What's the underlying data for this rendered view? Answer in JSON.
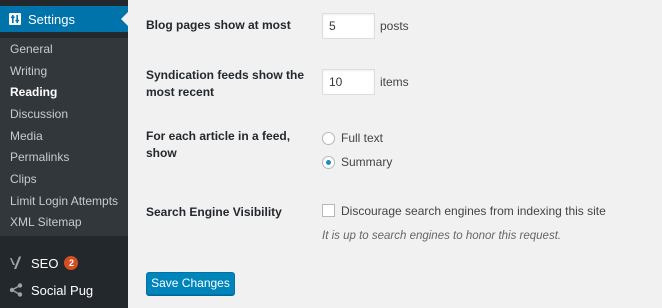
{
  "sidebar": {
    "settings_label": "Settings",
    "submenu": [
      {
        "label": "General",
        "current": false
      },
      {
        "label": "Writing",
        "current": false
      },
      {
        "label": "Reading",
        "current": true
      },
      {
        "label": "Discussion",
        "current": false
      },
      {
        "label": "Media",
        "current": false
      },
      {
        "label": "Permalinks",
        "current": false
      },
      {
        "label": "Clips",
        "current": false
      },
      {
        "label": "Limit Login Attempts",
        "current": false
      },
      {
        "label": "XML Sitemap",
        "current": false
      }
    ],
    "seo": {
      "label": "SEO",
      "badge": "2",
      "icon": "yoast-icon"
    },
    "social_pug": {
      "label": "Social Pug",
      "icon": "share-icon"
    }
  },
  "form": {
    "blog_pages": {
      "label": "Blog pages show at most",
      "value": "5",
      "unit": "posts"
    },
    "syndication": {
      "label_line1": "Syndication feeds show the",
      "label_line2": "most recent",
      "value": "10",
      "unit": "items"
    },
    "feed_article": {
      "label_line1": "For each article in a feed,",
      "label_line2": "show",
      "options": [
        {
          "label": "Full text",
          "selected": false
        },
        {
          "label": "Summary",
          "selected": true
        }
      ]
    },
    "search_visibility": {
      "label": "Search Engine Visibility",
      "checkbox_label": "Discourage search engines from indexing this site",
      "checked": false,
      "description": "It is up to search engines to honor this request."
    },
    "save_label": "Save Changes"
  },
  "colors": {
    "sidebar_bg": "#23282d",
    "submenu_bg": "#32373c",
    "accent": "#0073aa",
    "button": "#0085ba",
    "badge": "#d54e21",
    "page_bg": "#f1f1f1"
  }
}
